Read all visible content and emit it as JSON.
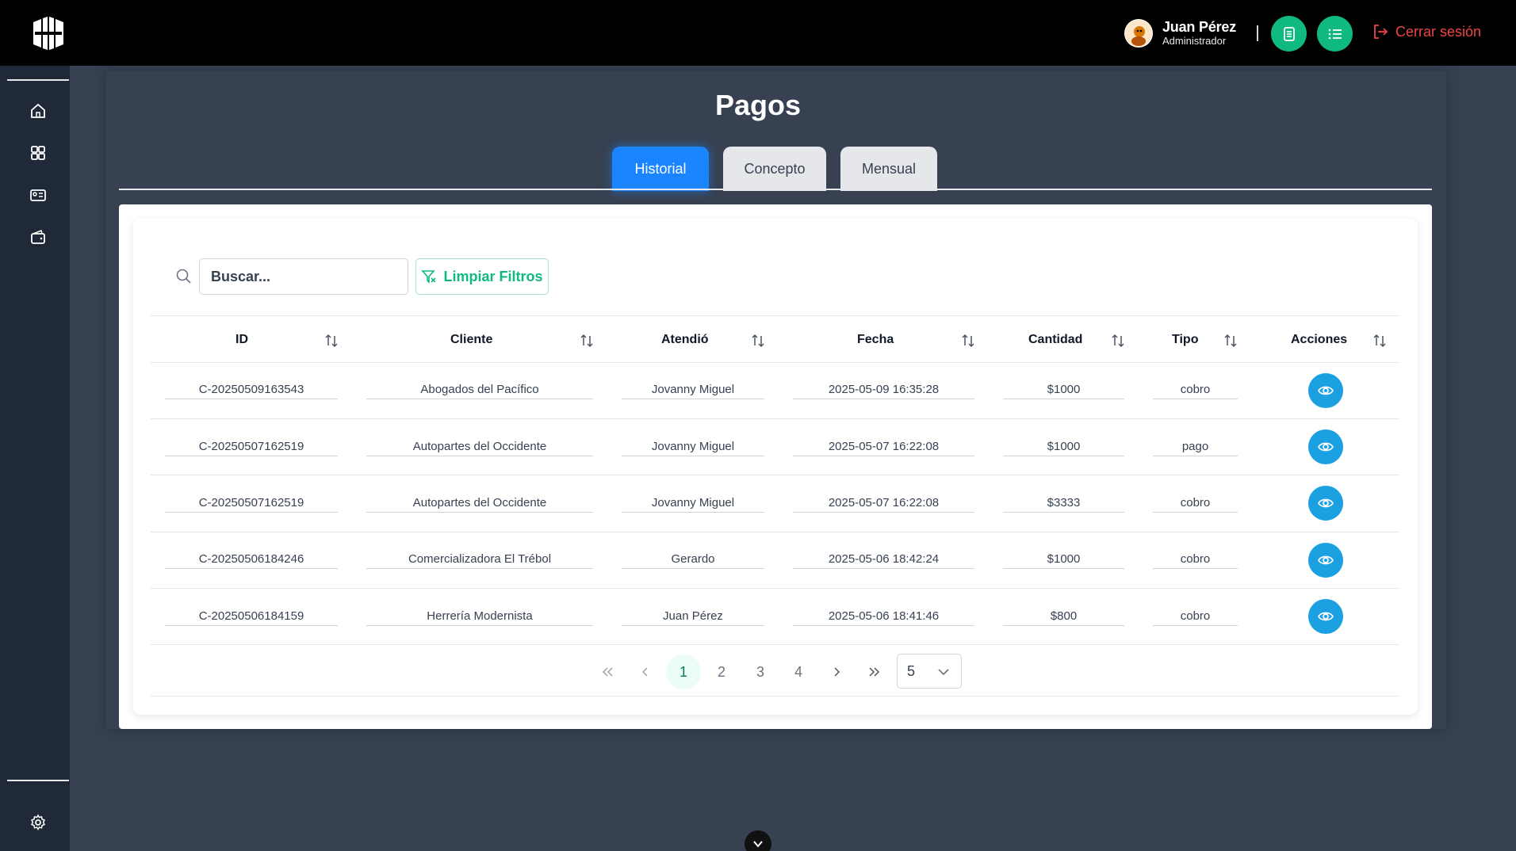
{
  "header": {
    "user_name": "Juan Pérez",
    "user_role": "Administrador",
    "logout_label": "Cerrar sesión",
    "accent_color": "#10b981",
    "logout_color": "#ef4444"
  },
  "page": {
    "title": "Pagos",
    "tabs": [
      {
        "label": "Historial",
        "active": true
      },
      {
        "label": "Concepto",
        "active": false
      },
      {
        "label": "Mensual",
        "active": false
      }
    ]
  },
  "filters": {
    "search_placeholder": "Buscar...",
    "clear_label": "Limpiar Filtros"
  },
  "table": {
    "columns": [
      "ID",
      "Cliente",
      "Atendió",
      "Fecha",
      "Cantidad",
      "Tipo",
      "Acciones"
    ],
    "rows": [
      {
        "id": "C-20250509163543",
        "cliente": "Abogados del Pacífico",
        "atendio": "Jovanny Miguel",
        "fecha": "2025-05-09 16:35:28",
        "cantidad": "$1000",
        "tipo": "cobro"
      },
      {
        "id": "C-20250507162519",
        "cliente": "Autopartes del Occidente",
        "atendio": "Jovanny Miguel",
        "fecha": "2025-05-07 16:22:08",
        "cantidad": "$1000",
        "tipo": "pago"
      },
      {
        "id": "C-20250507162519",
        "cliente": "Autopartes del Occidente",
        "atendio": "Jovanny Miguel",
        "fecha": "2025-05-07 16:22:08",
        "cantidad": "$3333",
        "tipo": "cobro"
      },
      {
        "id": "C-20250506184246",
        "cliente": "Comercializadora El Trébol",
        "atendio": "Gerardo",
        "fecha": "2025-05-06 18:42:24",
        "cantidad": "$1000",
        "tipo": "cobro"
      },
      {
        "id": "C-20250506184159",
        "cliente": "Herrería Modernista",
        "atendio": "Juan Pérez",
        "fecha": "2025-05-06 18:41:46",
        "cantidad": "$800",
        "tipo": "cobro"
      }
    ]
  },
  "pagination": {
    "pages": [
      "1",
      "2",
      "3",
      "4"
    ],
    "current": "1",
    "rows_per_page": "5"
  }
}
